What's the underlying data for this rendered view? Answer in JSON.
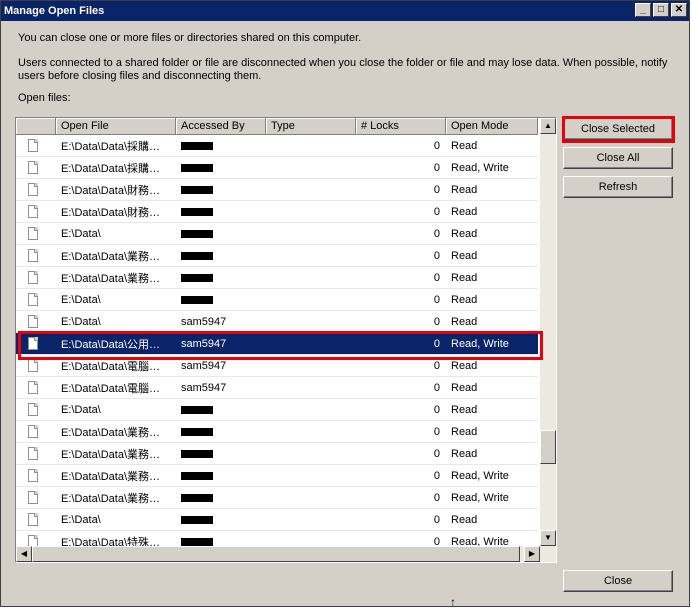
{
  "window": {
    "title": "Manage Open Files",
    "minimize_glyph": "_",
    "maximize_glyph": "□",
    "close_glyph": "✕"
  },
  "description": {
    "line1": "You can close one or more files or directories shared on this computer.",
    "line2": "Users connected to a shared folder or file are disconnected when you close the folder or file and may lose data. When possible, notify",
    "line3": "users before closing files and disconnecting them.",
    "open_files_label": "Open files:"
  },
  "table": {
    "columns": [
      "Open File",
      "Accessed By",
      "Type",
      "# Locks",
      "Open Mode"
    ],
    "rows": [
      {
        "file": "E:\\Data\\Data\\採購…",
        "user": "",
        "type": "",
        "locks": "0",
        "mode": "Read"
      },
      {
        "file": "E:\\Data\\Data\\採購…",
        "user": "",
        "type": "",
        "locks": "0",
        "mode": "Read, Write"
      },
      {
        "file": "E:\\Data\\Data\\財務…",
        "user": "",
        "type": "",
        "locks": "0",
        "mode": "Read"
      },
      {
        "file": "E:\\Data\\Data\\財務…",
        "user": "",
        "type": "",
        "locks": "0",
        "mode": "Read"
      },
      {
        "file": "E:\\Data\\",
        "user": "",
        "type": "",
        "locks": "0",
        "mode": "Read"
      },
      {
        "file": "E:\\Data\\Data\\業務…",
        "user": "",
        "type": "",
        "locks": "0",
        "mode": "Read"
      },
      {
        "file": "E:\\Data\\Data\\業務…",
        "user": "",
        "type": "",
        "locks": "0",
        "mode": "Read"
      },
      {
        "file": "E:\\Data\\",
        "user": "",
        "type": "",
        "locks": "0",
        "mode": "Read"
      },
      {
        "file": "E:\\Data\\",
        "user": "sam5947",
        "type": "",
        "locks": "0",
        "mode": "Read"
      },
      {
        "file": "E:\\Data\\Data\\公用…",
        "user": "sam5947",
        "type": "",
        "locks": "0",
        "mode": "Read, Write",
        "selected": true
      },
      {
        "file": "E:\\Data\\Data\\電腦…",
        "user": "sam5947",
        "type": "",
        "locks": "0",
        "mode": "Read"
      },
      {
        "file": "E:\\Data\\Data\\電腦…",
        "user": "sam5947",
        "type": "",
        "locks": "0",
        "mode": "Read"
      },
      {
        "file": "E:\\Data\\",
        "user": "",
        "type": "",
        "locks": "0",
        "mode": "Read"
      },
      {
        "file": "E:\\Data\\Data\\業務…",
        "user": "",
        "type": "",
        "locks": "0",
        "mode": "Read"
      },
      {
        "file": "E:\\Data\\Data\\業務…",
        "user": "",
        "type": "",
        "locks": "0",
        "mode": "Read"
      },
      {
        "file": "E:\\Data\\Data\\業務…",
        "user": "",
        "type": "",
        "locks": "0",
        "mode": "Read, Write"
      },
      {
        "file": "E:\\Data\\Data\\業務…",
        "user": "",
        "type": "",
        "locks": "0",
        "mode": "Read, Write"
      },
      {
        "file": "E:\\Data\\",
        "user": "",
        "type": "",
        "locks": "0",
        "mode": "Read"
      },
      {
        "file": "E:\\Data\\Data\\特殊…",
        "user": "",
        "type": "",
        "locks": "0",
        "mode": "Read, Write"
      }
    ]
  },
  "buttons": {
    "close_selected": "Close Selected",
    "close_all": "Close All",
    "refresh": "Refresh",
    "close": "Close"
  },
  "colors": {
    "highlight_border": "#e8000b",
    "selection": "#0a246a"
  }
}
